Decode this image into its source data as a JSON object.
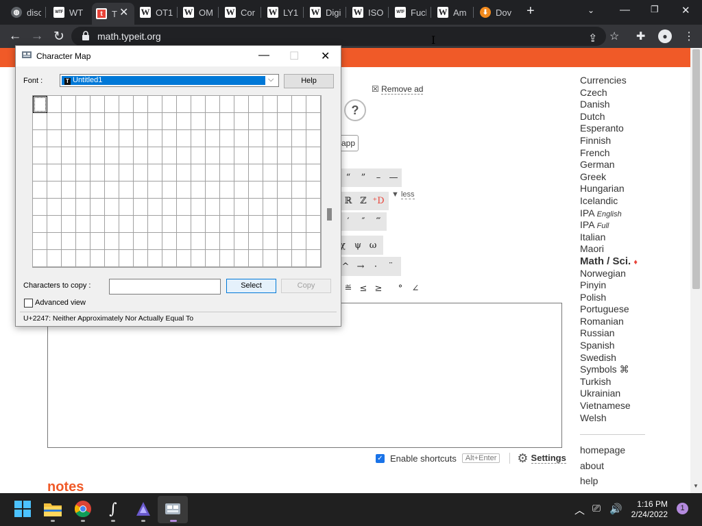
{
  "browser": {
    "tabs": [
      {
        "label": "disc",
        "icon": "globe-icon"
      },
      {
        "label": "WTI",
        "icon": "wtf-icon"
      },
      {
        "label": "T",
        "icon": "typeit-icon"
      },
      {
        "label": "OT1",
        "icon": "wikipedia-icon"
      },
      {
        "label": "OM",
        "icon": "wikipedia-icon"
      },
      {
        "label": "Cor",
        "icon": "wikipedia-icon"
      },
      {
        "label": "LY1",
        "icon": "wikipedia-icon"
      },
      {
        "label": "Digi",
        "icon": "wikipedia-icon"
      },
      {
        "label": "ISO",
        "icon": "wikipedia-icon"
      },
      {
        "label": "Fucl",
        "icon": "wtf-icon"
      },
      {
        "label": "Am",
        "icon": "wikipedia-icon"
      },
      {
        "label": "Dov",
        "icon": "download-icon"
      }
    ],
    "url": "math.typeit.org"
  },
  "page": {
    "remove_ad": "Remove ad",
    "help": "?",
    "app_button": "app",
    "less": "less",
    "symbol_rows": [
      [
        "“",
        "”",
        "–",
        "—"
      ],
      [
        "ℝ",
        "ℤ",
        "⁺D"
      ],
      [
        "′",
        "″",
        "‴"
      ],
      [
        "χ",
        "ψ",
        "ω"
      ],
      [
        "^",
        "→",
        "·",
        "¨"
      ],
      [
        "≝",
        "≤",
        "≥",
        "°",
        "∠"
      ]
    ],
    "enable_shortcuts": "Enable shortcuts",
    "shortcut_key": "Alt+Enter",
    "settings": "Settings",
    "notes_heading": "notes",
    "languages": [
      {
        "name": "Currencies",
        "suffix": ""
      },
      {
        "name": "Czech",
        "suffix": ""
      },
      {
        "name": "Danish",
        "suffix": ""
      },
      {
        "name": "Dutch",
        "suffix": ""
      },
      {
        "name": "Esperanto",
        "suffix": ""
      },
      {
        "name": "Finnish",
        "suffix": ""
      },
      {
        "name": "French",
        "suffix": ""
      },
      {
        "name": "German",
        "suffix": ""
      },
      {
        "name": "Greek",
        "suffix": ""
      },
      {
        "name": "Hungarian",
        "suffix": ""
      },
      {
        "name": "Icelandic",
        "suffix": ""
      },
      {
        "name": "IPA",
        "suffix": "English"
      },
      {
        "name": "IPA",
        "suffix": "Full"
      },
      {
        "name": "Italian",
        "suffix": ""
      },
      {
        "name": "Maori",
        "suffix": ""
      },
      {
        "name": "Math / Sci.",
        "suffix": ""
      },
      {
        "name": "Norwegian",
        "suffix": ""
      },
      {
        "name": "Pinyin",
        "suffix": ""
      },
      {
        "name": "Polish",
        "suffix": ""
      },
      {
        "name": "Portuguese",
        "suffix": ""
      },
      {
        "name": "Romanian",
        "suffix": ""
      },
      {
        "name": "Russian",
        "suffix": ""
      },
      {
        "name": "Spanish",
        "suffix": ""
      },
      {
        "name": "Swedish",
        "suffix": ""
      },
      {
        "name": "Symbols ⌘",
        "suffix": ""
      },
      {
        "name": "Turkish",
        "suffix": ""
      },
      {
        "name": "Ukrainian",
        "suffix": ""
      },
      {
        "name": "Vietnamese",
        "suffix": ""
      },
      {
        "name": "Welsh",
        "suffix": ""
      }
    ],
    "current_language_marker": "♦",
    "footer_links": [
      "homepage",
      "about",
      "help"
    ]
  },
  "charmap": {
    "title": "Character Map",
    "font_label": "Font :",
    "font_value": "Untitled1",
    "help_button": "Help",
    "grid_rows": 10,
    "grid_cols": 20,
    "copy_label": "Characters to copy :",
    "copy_value": "",
    "select_button": "Select",
    "copy_button": "Copy",
    "advanced_view": "Advanced view",
    "status": "U+2247: Neither Approximately Nor Actually Equal To"
  },
  "taskbar": {
    "time": "1:16 PM",
    "date": "2/24/2022",
    "notifications": "1"
  },
  "colors": {
    "accent": "#f05a28",
    "selection": "#0078d7",
    "chrome_dark": "#202124"
  }
}
